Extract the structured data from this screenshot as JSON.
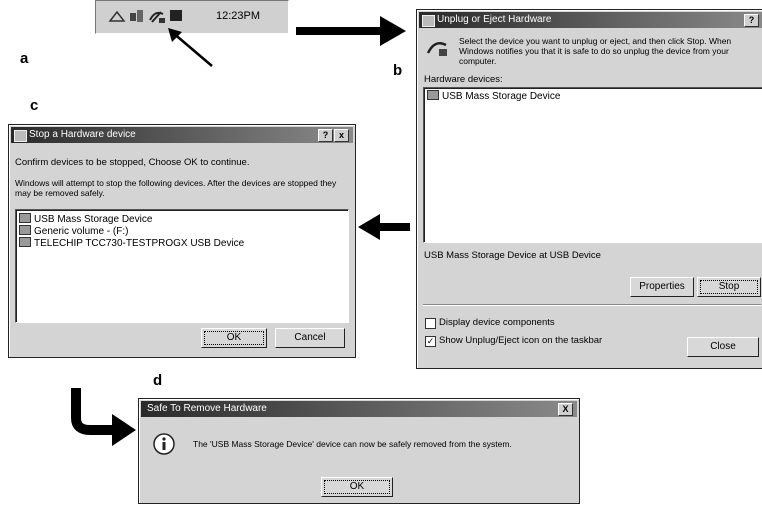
{
  "labels": {
    "a": "a",
    "b": "b",
    "c": "c",
    "d": "d"
  },
  "taskbar": {
    "clock": "12:23PM"
  },
  "unplug_window": {
    "title": "Unplug or Eject Hardware",
    "help_btn": "?",
    "instructions": "Select the device you want to unplug or eject, and then click Stop. When Windows notifies you that it is safe to do so unplug the device from your computer.",
    "list_label": "Hardware devices:",
    "devices": [
      "USB Mass Storage Device"
    ],
    "status": "USB Mass Storage Device at USB Device",
    "properties_btn": "Properties",
    "stop_btn": "Stop",
    "display_components": "Display device components",
    "show_taskbar": "Show Unplug/Eject icon on the taskbar",
    "close_btn": "Close"
  },
  "stop_window": {
    "title": "Stop a Hardware device",
    "help_btn": "?",
    "close_x": "x",
    "confirm": "Confirm devices to be stopped, Choose OK to continue.",
    "info": "Windows will attempt to stop the following devices. After the devices are stopped they may be removed safely.",
    "devices": [
      "USB Mass Storage Device",
      "Generic volume - (F:)",
      "TELECHIP TCC730-TESTPROGX USB Device"
    ],
    "ok_btn": "OK",
    "cancel_btn": "Cancel"
  },
  "safe_window": {
    "title": "Safe To Remove Hardware",
    "close_x": "X",
    "message": "The 'USB Mass Storage Device' device can now be safely removed from the system.",
    "ok_btn": "OK"
  }
}
